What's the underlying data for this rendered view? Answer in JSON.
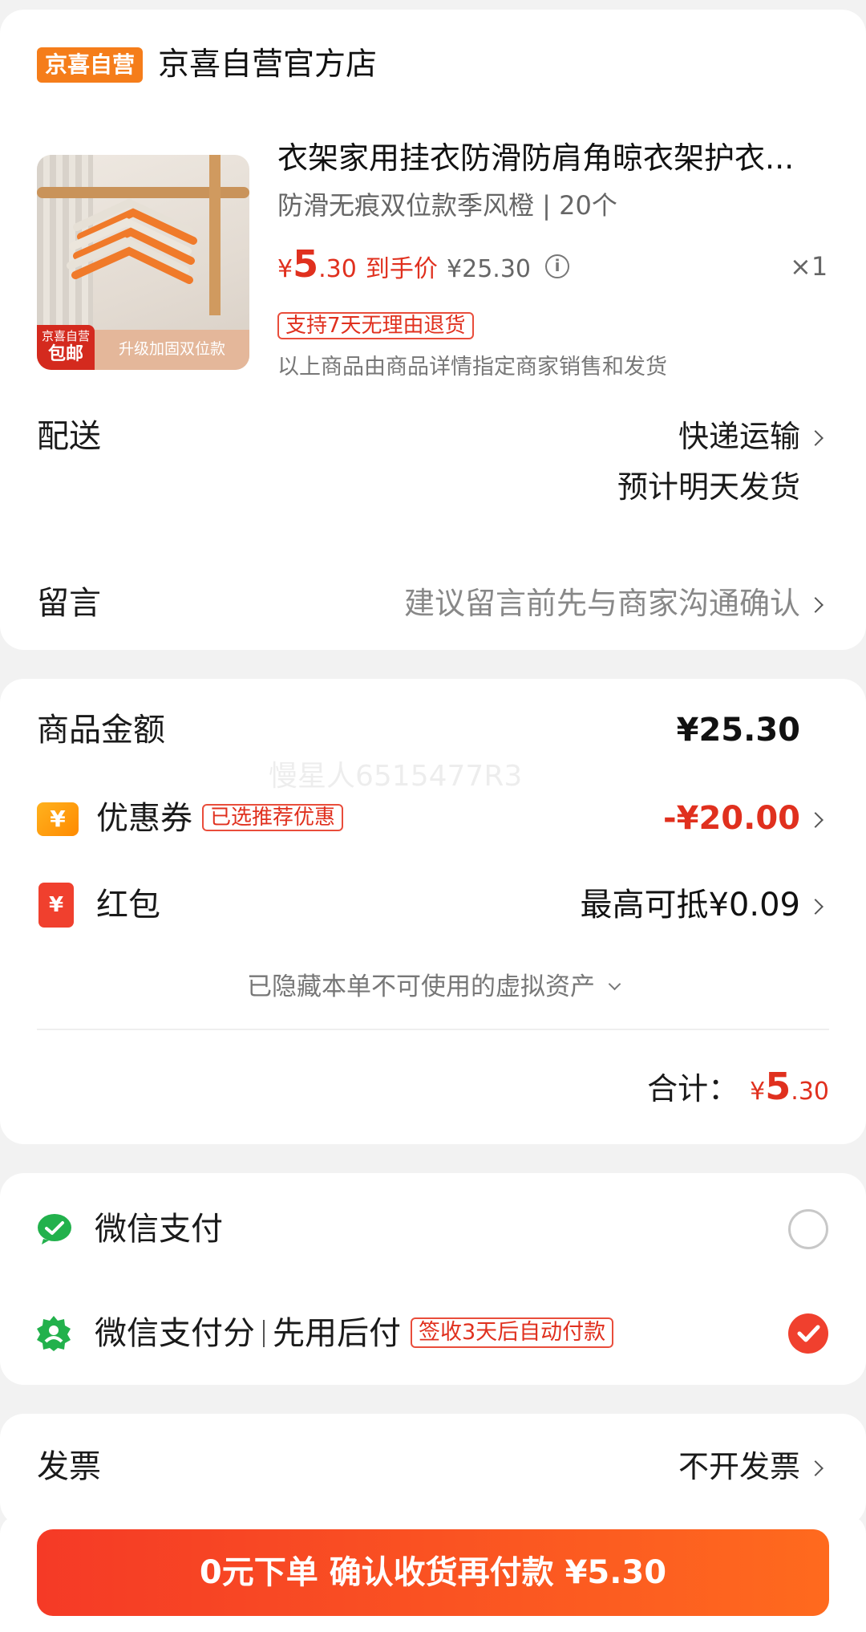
{
  "store": {
    "badge": "京喜自营",
    "name": "京喜自营官方店"
  },
  "product": {
    "title": "衣架家用挂衣防滑防肩角晾衣架护衣...",
    "spec": "防滑无痕双位款季风橙 | 20个",
    "price_symbol": "¥",
    "price_int": "5",
    "price_dec": ".30",
    "price_tag": "到手价",
    "orig_price": "¥25.30",
    "quantity": "×1",
    "return_policy": "支持7天无理由退货",
    "seller_note": "以上商品由商品详情指定商家销售和发货",
    "image_badge_top": "京喜自营",
    "image_badge_bottom": "包邮",
    "image_caption": "升级加固双位款"
  },
  "delivery": {
    "label": "配送",
    "method": "快递运输",
    "eta": "预计明天发货"
  },
  "message": {
    "label": "留言",
    "placeholder": "建议留言前先与商家沟通确认"
  },
  "amount": {
    "label": "商品金额",
    "value": "¥25.30",
    "watermark": "慢星人6515477R3",
    "coupon_label": "优惠券",
    "coupon_tag": "已选推荐优惠",
    "coupon_value": "-¥20.00",
    "redpacket_label": "红包",
    "redpacket_value": "最高可抵¥0.09",
    "hidden_assets": "已隐藏本单不可使用的虚拟资产",
    "total_label": "合计：",
    "total_symbol": "¥",
    "total_int": "5",
    "total_dec": ".30"
  },
  "payment": {
    "wechat_pay": "微信支付",
    "wechat_score": "微信支付分",
    "pay_later": "先用后付",
    "pay_later_tag": "签收3天后自动付款",
    "selected": "wechat_score"
  },
  "invoice": {
    "label": "发票",
    "value": "不开发票"
  },
  "submit": {
    "label": "0元下单 确认收货再付款 ¥5.30"
  },
  "colors": {
    "accent": "#e0301e",
    "wechat_green": "#22b14c",
    "button_start": "#f53a26",
    "button_end": "#ff6a1e"
  }
}
